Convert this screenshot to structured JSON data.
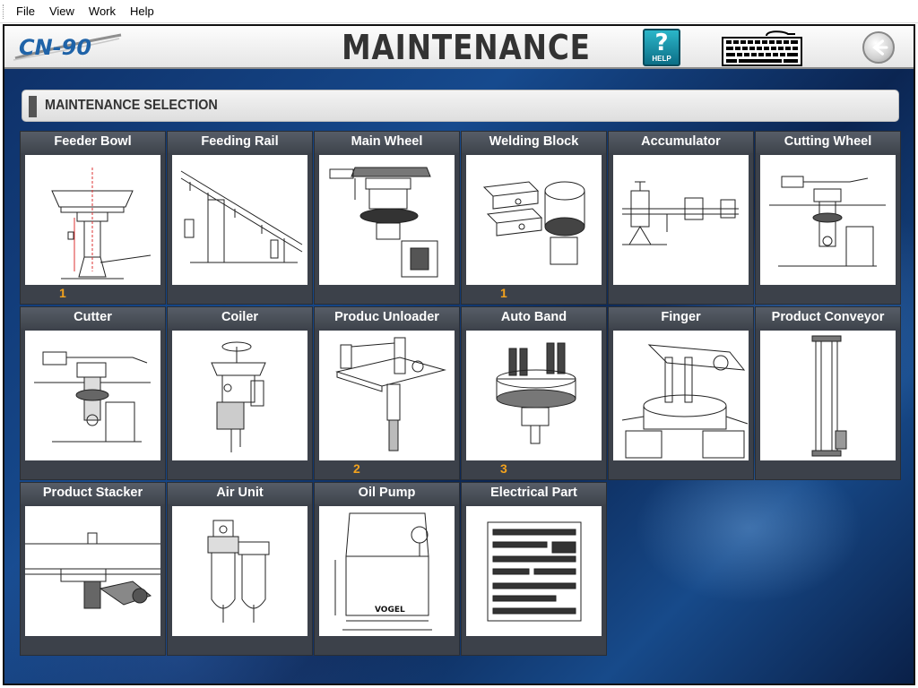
{
  "menu": [
    "File",
    "View",
    "Work",
    "Help"
  ],
  "header": {
    "logo_text": "CN-90",
    "title": "MAINTENANCE",
    "help_label": "?",
    "help_sub": "HELP"
  },
  "section": {
    "label": "MAINTENANCE SELECTION"
  },
  "tiles": [
    {
      "name": "Feeder Bowl",
      "count": "1"
    },
    {
      "name": "Feeding Rail",
      "count": ""
    },
    {
      "name": "Main Wheel",
      "count": ""
    },
    {
      "name": "Welding Block",
      "count": "1"
    },
    {
      "name": "Accumulator",
      "count": ""
    },
    {
      "name": "Cutting Wheel",
      "count": ""
    },
    {
      "name": "Cutter",
      "count": ""
    },
    {
      "name": "Coiler",
      "count": ""
    },
    {
      "name": "Produc Unloader",
      "count": "2"
    },
    {
      "name": "Auto Band",
      "count": "3"
    },
    {
      "name": "Finger",
      "count": ""
    },
    {
      "name": "Product Conveyor",
      "count": ""
    },
    {
      "name": "Product Stacker",
      "count": ""
    },
    {
      "name": "Air Unit",
      "count": ""
    },
    {
      "name": "Oil Pump",
      "count": ""
    },
    {
      "name": "Electrical Part",
      "count": ""
    }
  ],
  "diagram_labels": {
    "oil_pump_brand": "VOGEL"
  },
  "icons": {
    "help": "help-icon",
    "keyboard": "keyboard-icon",
    "back": "back-arrow-icon"
  },
  "colors": {
    "accent_count": "#f3a21d",
    "tile_bg": "#3c414a",
    "header_bg": "#e6e6e6",
    "help_bg": "#0c6e86"
  }
}
